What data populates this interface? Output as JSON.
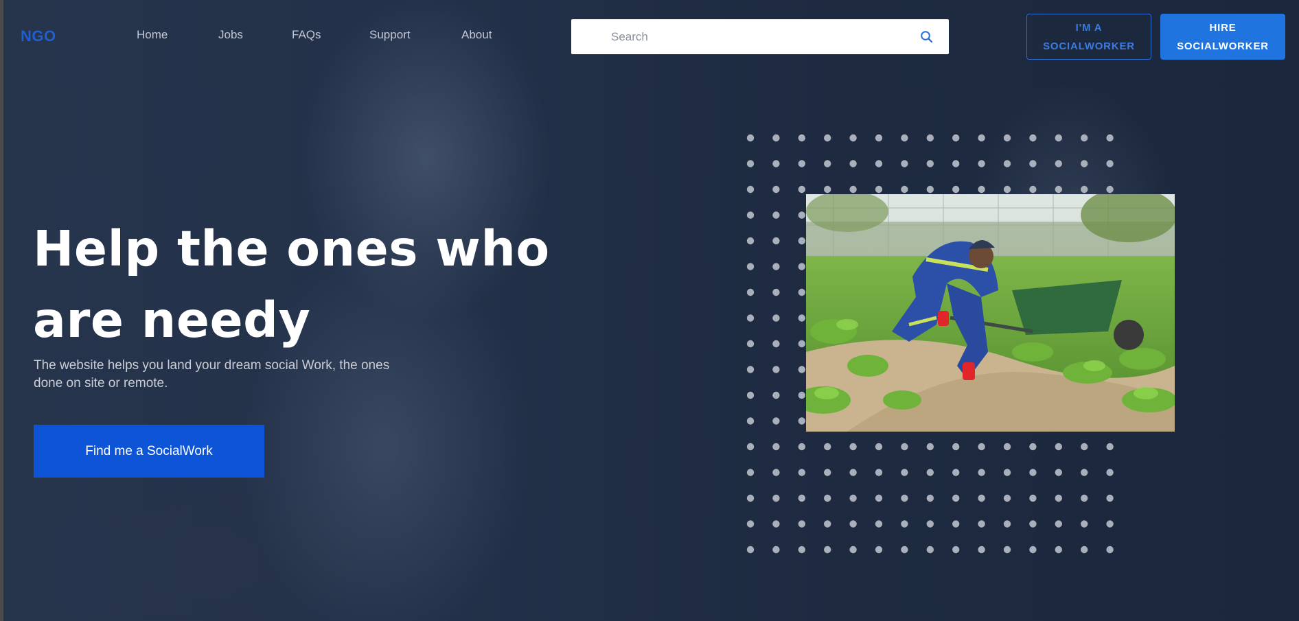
{
  "brand": {
    "logo_text": "NGO",
    "logo_color": "#1f5fcf"
  },
  "nav": {
    "links": [
      "Home",
      "Jobs",
      "FAQs",
      "Support",
      "About"
    ]
  },
  "search": {
    "placeholder": "Search",
    "value": "",
    "icon": "search-icon"
  },
  "header_buttons": {
    "socialworker": {
      "line1": "I'M A",
      "line2": "SOCIALWORKER"
    },
    "hire": {
      "line1": "HIRE",
      "line2": "SOCIALWORKER"
    }
  },
  "hero": {
    "title_line1": "Help the ones who",
    "title_line2": "are needy",
    "subtitle_line1": "The website helps you land your dream social Work, the ones",
    "subtitle_line2": "done on site or remote.",
    "cta_label": "Find me a SocialWork"
  },
  "colors": {
    "background": "#1e2a3f",
    "accent": "#1f74e0",
    "cta": "#0d55d6",
    "dots": "#a9b0bb"
  }
}
